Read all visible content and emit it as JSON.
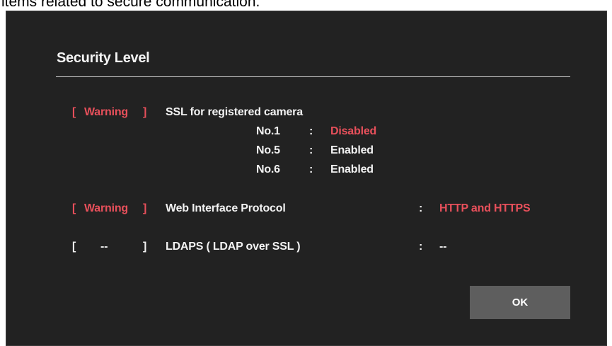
{
  "caption": "items related to secure communication.",
  "dialog": {
    "title": "Security Level",
    "ok_label": "OK",
    "colors": {
      "background": "#222222",
      "warning": "#e8505b",
      "button": "#5e5e5e"
    },
    "items": [
      {
        "status_open": "[",
        "status": "Warning",
        "status_close": "]",
        "label": "SSL for registered camera",
        "cameras": [
          {
            "name": "No.1",
            "separator": ":",
            "value": "Disabled"
          },
          {
            "name": "No.5",
            "separator": ":",
            "value": "Enabled"
          },
          {
            "name": "No.6",
            "separator": ":",
            "value": "Enabled"
          }
        ]
      },
      {
        "status_open": "[",
        "status": "Warning",
        "status_close": "]",
        "label": "Web Interface Protocol",
        "separator": ":",
        "value": "HTTP and HTTPS"
      },
      {
        "status_open": "[",
        "status": "--",
        "status_close": "]",
        "label": "LDAPS ( LDAP over SSL )",
        "separator": ":",
        "value": "--"
      }
    ]
  }
}
